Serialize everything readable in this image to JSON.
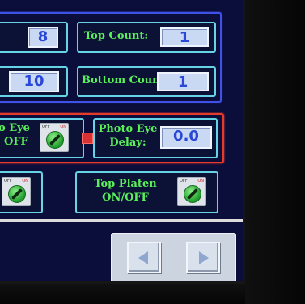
{
  "counts_group": {
    "top_row": {
      "partial_value": "8",
      "label": "Top Count:",
      "value": "1"
    },
    "bottom_row": {
      "partial_value": "10",
      "label": "Bottom Count",
      "value": "1"
    }
  },
  "photo_eye_group": {
    "partial_label_line1": "o Eye",
    "partial_label_line2": "OFF",
    "delay_label_line1": "Photo Eye",
    "delay_label_line2": "Delay:",
    "delay_value": "0.0"
  },
  "top_platen": {
    "label_line1": "Top Platen",
    "label_line2": "ON/OFF"
  },
  "switch_tags": {
    "off": "OFF",
    "on": "ON"
  },
  "colors": {
    "screen_bg": "#0b0d3a",
    "label_green": "#5af05a",
    "panel_border": "#66d4e4",
    "group_blue": "#3e52e8",
    "group_red": "#e43b2a",
    "value_text": "#2a48d8",
    "indicator_red": "#d93232"
  },
  "icons": {
    "nav_prev": "left-triangle-arrow-icon",
    "nav_next": "right-triangle-arrow-icon",
    "toggle": "rotary-selector-switch-icon"
  }
}
